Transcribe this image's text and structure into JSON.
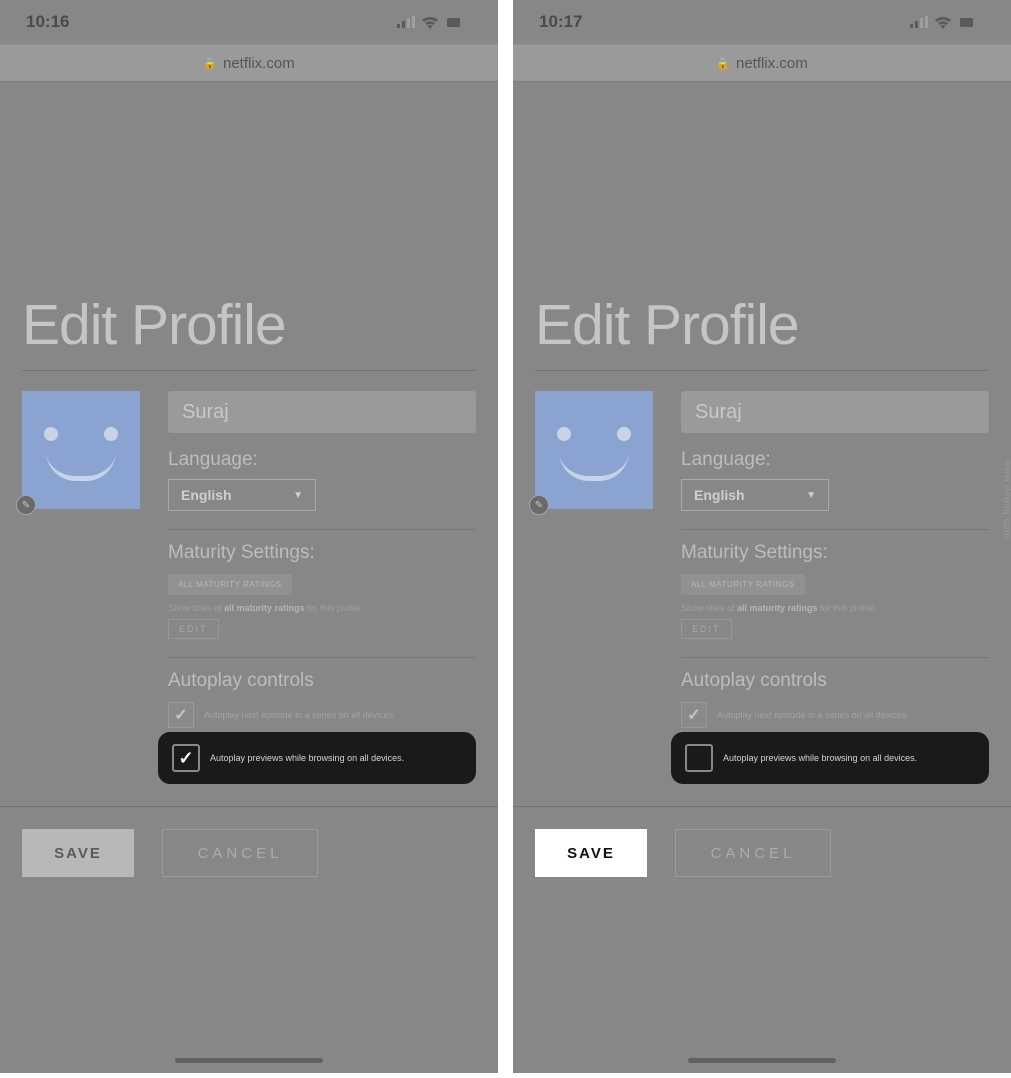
{
  "watermark": "www.deuaq.com",
  "left": {
    "status_time": "10:16",
    "browser_domain": "netflix.com",
    "title": "Edit Profile",
    "profile_name": "Suraj",
    "language_label": "Language:",
    "language_value": "English",
    "maturity_label": "Maturity Settings:",
    "maturity_badge": "ALL MATURITY RATINGS",
    "maturity_text_pre": "Show titles of ",
    "maturity_text_bold": "all maturity ratings",
    "maturity_text_post": " for this profile.",
    "edit_label": "EDIT",
    "autoplay_label": "Autoplay controls",
    "autoplay_opt1": "Autoplay next episode in a series on all devices.",
    "autoplay_opt2": "Autoplay previews while browsing on all devices.",
    "autoplay_opt2_checked": true,
    "save_label": "SAVE",
    "save_active": false,
    "cancel_label": "CANCEL"
  },
  "right": {
    "status_time": "10:17",
    "browser_domain": "netflix.com",
    "title": "Edit Profile",
    "profile_name": "Suraj",
    "language_label": "Language:",
    "language_value": "English",
    "maturity_label": "Maturity Settings:",
    "maturity_badge": "ALL MATURITY RATINGS",
    "maturity_text_pre": "Show titles of ",
    "maturity_text_bold": "all maturity ratings",
    "maturity_text_post": " for this profile.",
    "edit_label": "EDIT",
    "autoplay_label": "Autoplay controls",
    "autoplay_opt1": "Autoplay next episode in a series on all devices.",
    "autoplay_opt2": "Autoplay previews while browsing on all devices.",
    "autoplay_opt2_checked": false,
    "save_label": "SAVE",
    "save_active": true,
    "cancel_label": "CANCEL"
  }
}
